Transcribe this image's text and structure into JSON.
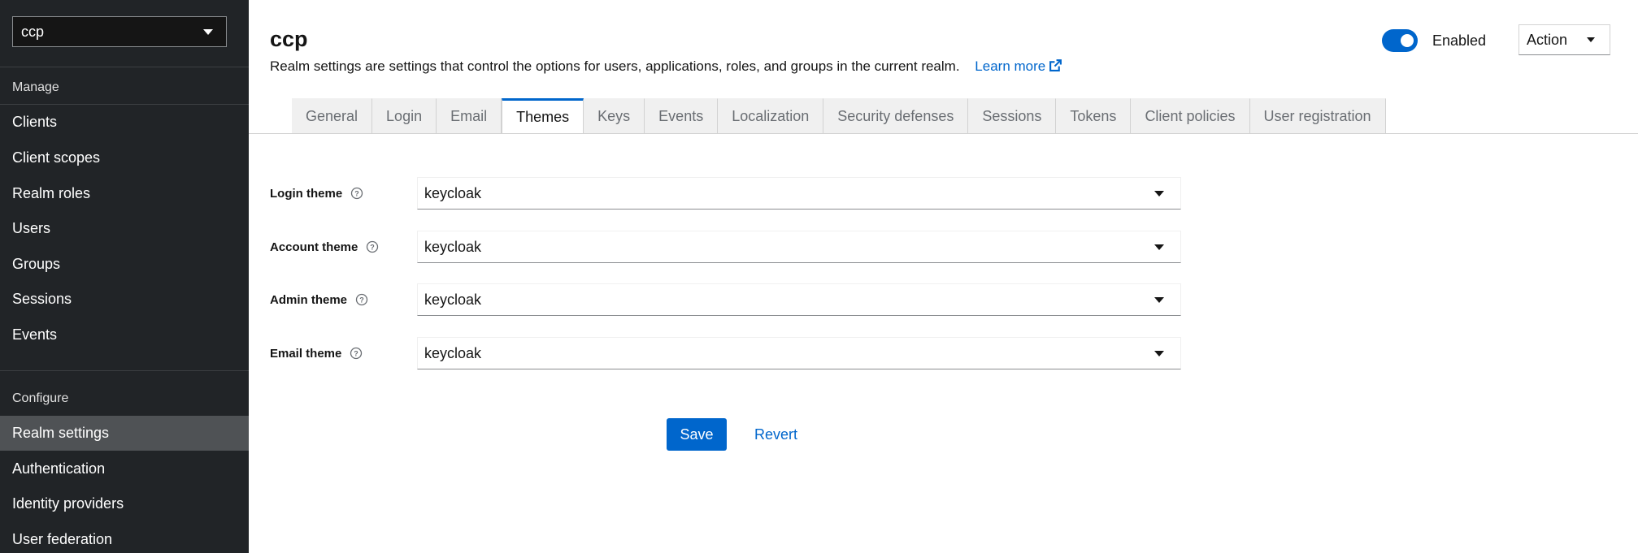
{
  "sidebar": {
    "realm_selector": "ccp",
    "sections": [
      {
        "title": "Manage",
        "items": [
          {
            "label": "Clients"
          },
          {
            "label": "Client scopes"
          },
          {
            "label": "Realm roles"
          },
          {
            "label": "Users"
          },
          {
            "label": "Groups"
          },
          {
            "label": "Sessions"
          },
          {
            "label": "Events"
          }
        ]
      },
      {
        "title": "Configure",
        "items": [
          {
            "label": "Realm settings",
            "active": true
          },
          {
            "label": "Authentication"
          },
          {
            "label": "Identity providers"
          },
          {
            "label": "User federation"
          }
        ]
      }
    ]
  },
  "header": {
    "title": "ccp",
    "description": "Realm settings are settings that control the options for users, applications, roles, and groups in the current realm.",
    "learn_more": "Learn more",
    "enabled_label": "Enabled",
    "action_label": "Action"
  },
  "tabs": [
    {
      "label": "General"
    },
    {
      "label": "Login"
    },
    {
      "label": "Email"
    },
    {
      "label": "Themes",
      "active": true
    },
    {
      "label": "Keys"
    },
    {
      "label": "Events"
    },
    {
      "label": "Localization"
    },
    {
      "label": "Security defenses"
    },
    {
      "label": "Sessions"
    },
    {
      "label": "Tokens"
    },
    {
      "label": "Client policies"
    },
    {
      "label": "User registration"
    }
  ],
  "themes_form": {
    "fields": [
      {
        "label": "Login theme",
        "value": "keycloak"
      },
      {
        "label": "Account theme",
        "value": "keycloak"
      },
      {
        "label": "Admin theme",
        "value": "keycloak"
      },
      {
        "label": "Email theme",
        "value": "keycloak"
      }
    ],
    "save_label": "Save",
    "revert_label": "Revert"
  },
  "colors": {
    "accent": "#0066cc",
    "sidebar_bg": "#212427",
    "sidebar_active": "#4f5255"
  }
}
